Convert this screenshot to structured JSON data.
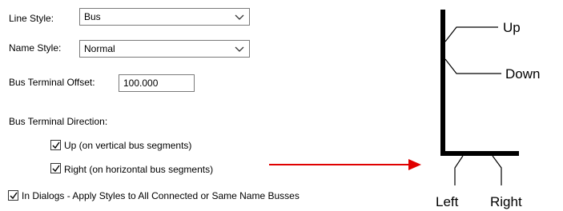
{
  "line_style": {
    "label": "Line Style:",
    "value": "Bus"
  },
  "name_style": {
    "label": "Name Style:",
    "value": "Normal"
  },
  "bus_terminal_offset": {
    "label": "Bus Terminal Offset:",
    "value": "100.000"
  },
  "bus_terminal_direction": {
    "label": "Bus Terminal Direction:",
    "up": {
      "checked": true,
      "label": "Up  (on vertical bus segments)"
    },
    "right": {
      "checked": true,
      "label": "Right  (on horizontal bus segments)"
    }
  },
  "apply_styles": {
    "checked": true,
    "label": "In Dialogs - Apply Styles to All Connected or Same Name Busses"
  },
  "diagram": {
    "labels": {
      "up": "Up",
      "down": "Down",
      "left": "Left",
      "right": "Right"
    },
    "arrow_color": "#e00000"
  }
}
